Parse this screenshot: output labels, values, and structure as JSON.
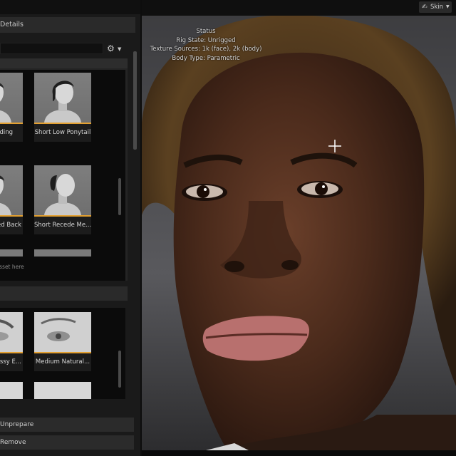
{
  "details_panel": {
    "tab_label": "Details",
    "search": {
      "value": "",
      "placeholder": ""
    },
    "options_icon": "gear-icon",
    "hair_section": {
      "cards": [
        {
          "label": "Braiding"
        },
        {
          "label": "Short Low Ponytail"
        },
        {
          "label": "Combed Back"
        },
        {
          "label": "Short Recede Me..."
        }
      ],
      "hint": "Asset here"
    },
    "eyebrow_section": {
      "cards": [
        {
          "label": "Messy E..."
        },
        {
          "label": "Medium Natural..."
        }
      ]
    },
    "buttons": {
      "unprepare": "Unprepare",
      "remove": "Remove"
    },
    "accent_color": "#e3a031"
  },
  "viewport": {
    "view_mode": {
      "icon": "skin-icon",
      "label": "Skin"
    },
    "status": {
      "title": "Status",
      "rig_state": "Rig State: Unrigged",
      "texture_sources": "Texture Sources: 1k (face), 2k (body)",
      "body_type": "Body Type: Parametric"
    }
  }
}
